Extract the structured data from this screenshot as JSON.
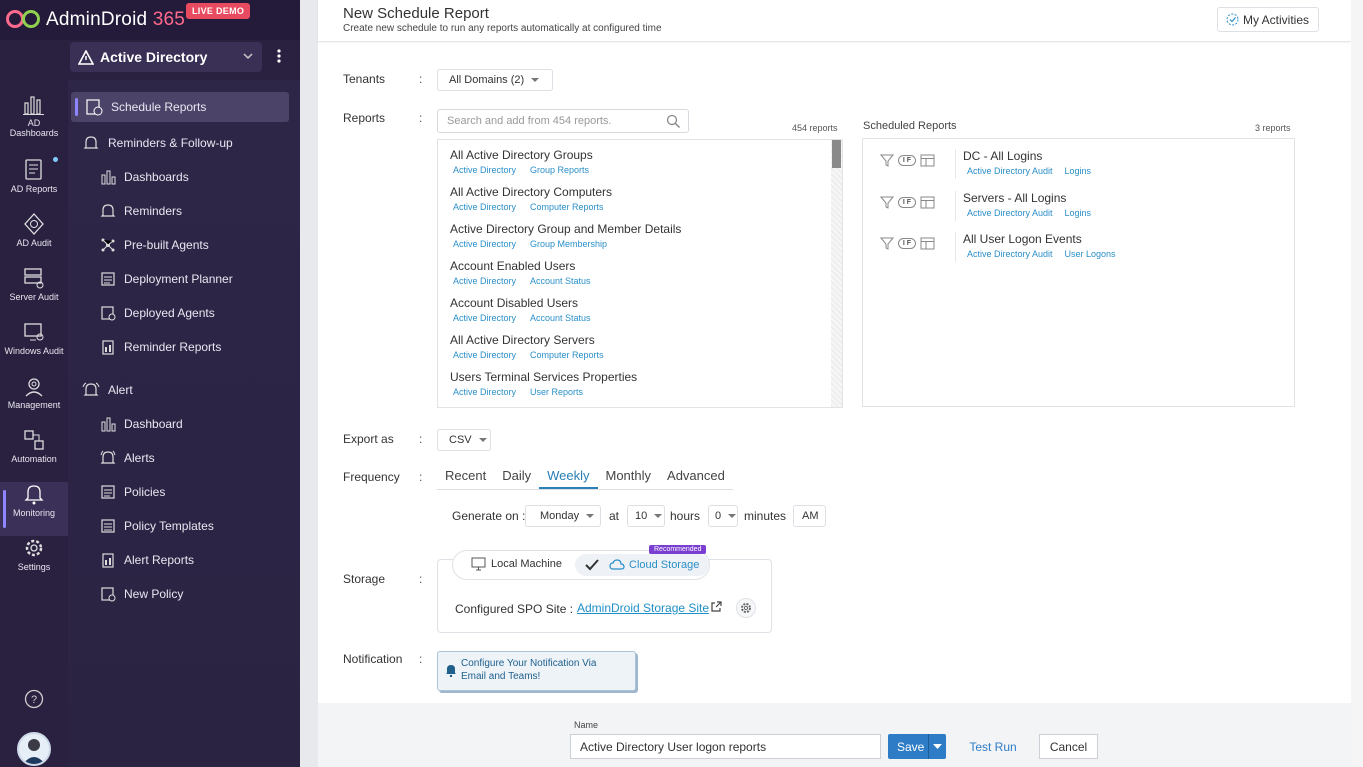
{
  "brand": {
    "name": "AdminDroid",
    "suffix": "365",
    "badge": "LIVE DEMO"
  },
  "workspace": {
    "label": "Active Directory"
  },
  "rail": [
    {
      "label_line1": "AD",
      "label_line2": "Dashboards",
      "icon": "bar-chart-icon"
    },
    {
      "label_line1": "AD Reports",
      "label_line2": "",
      "icon": "report-icon"
    },
    {
      "label_line1": "AD Audit",
      "label_line2": "",
      "icon": "audit-icon"
    },
    {
      "label_line1": "Server Audit",
      "label_line2": "",
      "icon": "server-audit-icon"
    },
    {
      "label_line1": "Windows Audit",
      "label_line2": "",
      "icon": "windows-audit-icon"
    },
    {
      "label_line1": "Management",
      "label_line2": "",
      "icon": "management-icon"
    },
    {
      "label_line1": "Automation",
      "label_line2": "",
      "icon": "automation-icon"
    },
    {
      "label_line1": "Monitoring",
      "label_line2": "",
      "icon": "monitoring-icon"
    },
    {
      "label_line1": "Settings",
      "label_line2": "",
      "icon": "settings-icon"
    }
  ],
  "nav": {
    "schedule_reports": "Schedule Reports",
    "reminders": "Reminders & Follow-up",
    "dashboards": "Dashboards",
    "reminders_sub": "Reminders",
    "prebuilt_agents": "Pre-built Agents",
    "deployment_planner": "Deployment Planner",
    "deployed_agents": "Deployed Agents",
    "reminder_reports": "Reminder Reports",
    "alert": "Alert",
    "alert_dashboard": "Dashboard",
    "alerts": "Alerts",
    "policies": "Policies",
    "policy_templates": "Policy Templates",
    "alert_reports": "Alert Reports",
    "new_policy": "New Policy"
  },
  "header": {
    "title": "New Schedule Report",
    "subtitle": "Create new schedule to run any reports automatically at configured time",
    "my_activities": "My Activities"
  },
  "form": {
    "colon": ":",
    "tenants_label": "Tenants",
    "tenants_value": "All Domains (2)",
    "reports_label": "Reports",
    "search_placeholder": "Search and add from 454 reports.",
    "reports_count": "454 reports",
    "reports": [
      {
        "title": "All Active Directory Groups",
        "tag1": "Active Directory",
        "tag2": "Group Reports"
      },
      {
        "title": "All Active Directory Computers",
        "tag1": "Active Directory",
        "tag2": "Computer Reports"
      },
      {
        "title": "Active Directory Group and Member Details",
        "tag1": "Active Directory",
        "tag2": "Group Membership"
      },
      {
        "title": "Account Enabled Users",
        "tag1": "Active Directory",
        "tag2": "Account Status"
      },
      {
        "title": "Account Disabled Users",
        "tag1": "Active Directory",
        "tag2": "Account Status"
      },
      {
        "title": "All Active Directory Servers",
        "tag1": "Active Directory",
        "tag2": "Computer Reports"
      },
      {
        "title": "Users Terminal Services Properties",
        "tag1": "Active Directory",
        "tag2": "User Reports"
      }
    ],
    "scheduled_label": "Scheduled Reports",
    "scheduled_count": "3 reports",
    "scheduled": [
      {
        "title": "DC - All Logins",
        "tag1": "Active Directory Audit",
        "tag2": "Logins",
        "badge": "I F"
      },
      {
        "title": "Servers - All Logins",
        "tag1": "Active Directory Audit",
        "tag2": "Logins",
        "badge": "I F"
      },
      {
        "title": "All User Logon Events",
        "tag1": "Active Directory Audit",
        "tag2": "User Logons",
        "badge": "I F"
      }
    ],
    "export_label": "Export as",
    "export_value": "CSV",
    "frequency_label": "Frequency",
    "tabs": [
      "Recent",
      "Daily",
      "Weekly",
      "Monthly",
      "Advanced"
    ],
    "active_tab": "Weekly",
    "generate_on_label": "Generate on :",
    "day_value": "Monday",
    "at_label": "at",
    "hours_value": "10",
    "hours_label": "hours",
    "minutes_value": "0",
    "minutes_label": "minutes",
    "ampm": "AM",
    "storage_label": "Storage",
    "local_machine": "Local Machine",
    "cloud_storage": "Cloud Storage",
    "recommended": "Recommended",
    "spo_label": "Configured SPO Site :",
    "spo_link": "AdminDroid Storage Site",
    "notification_label": "Notification",
    "notification_line1": "Configure Your Notification Via",
    "notification_line2": "Email and Teams!"
  },
  "footer": {
    "name_label": "Name",
    "name_value": "Active Directory User logon reports",
    "save": "Save",
    "test_run": "Test Run",
    "cancel": "Cancel"
  },
  "colors": {
    "accent": "#2e7cc6",
    "sidebar": "#2a2141",
    "tag": "#2a8fc9",
    "badge": "#e84a5f"
  }
}
